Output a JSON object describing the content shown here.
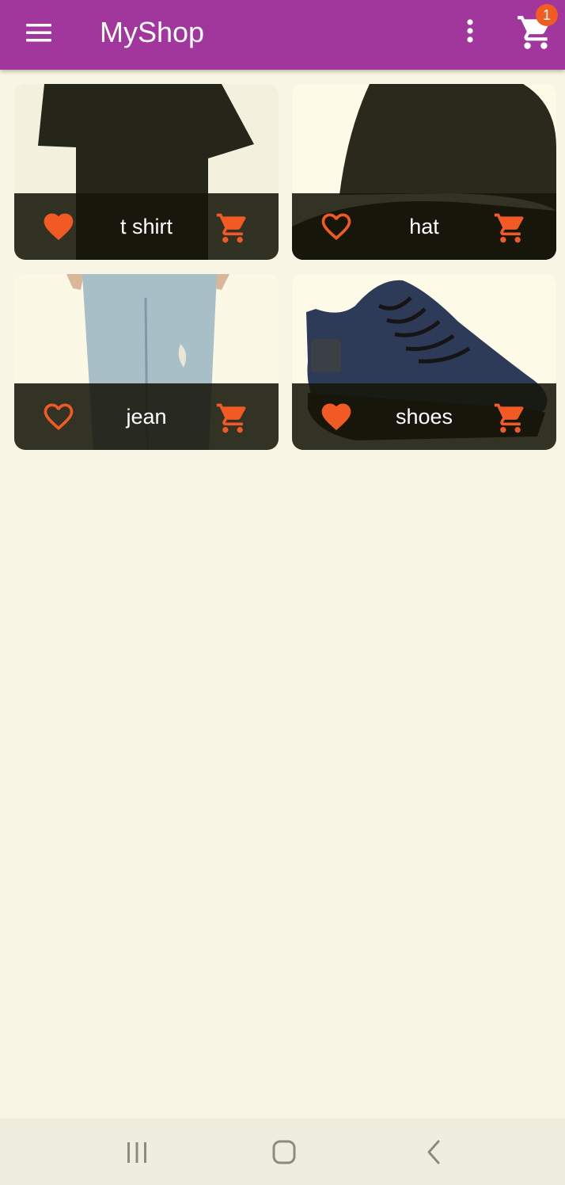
{
  "appbar": {
    "title": "MyShop",
    "cart_badge": "1",
    "background": "#a1369c"
  },
  "icons": {
    "menu": "hamburger-menu-icon",
    "more": "vertical-dots-icon",
    "cart": "shopping-cart-icon",
    "favorite_filled": "heart-filled-icon",
    "favorite_outline": "heart-outline-icon",
    "add_to_cart": "add-to-cart-icon",
    "recents": "recent-apps-icon",
    "home": "home-icon",
    "back": "back-icon"
  },
  "accent": "#f15a22",
  "products": [
    {
      "name": "t shirt",
      "favorite": true
    },
    {
      "name": "hat",
      "favorite": false
    },
    {
      "name": "jean",
      "favorite": false
    },
    {
      "name": "shoes",
      "favorite": true
    }
  ]
}
